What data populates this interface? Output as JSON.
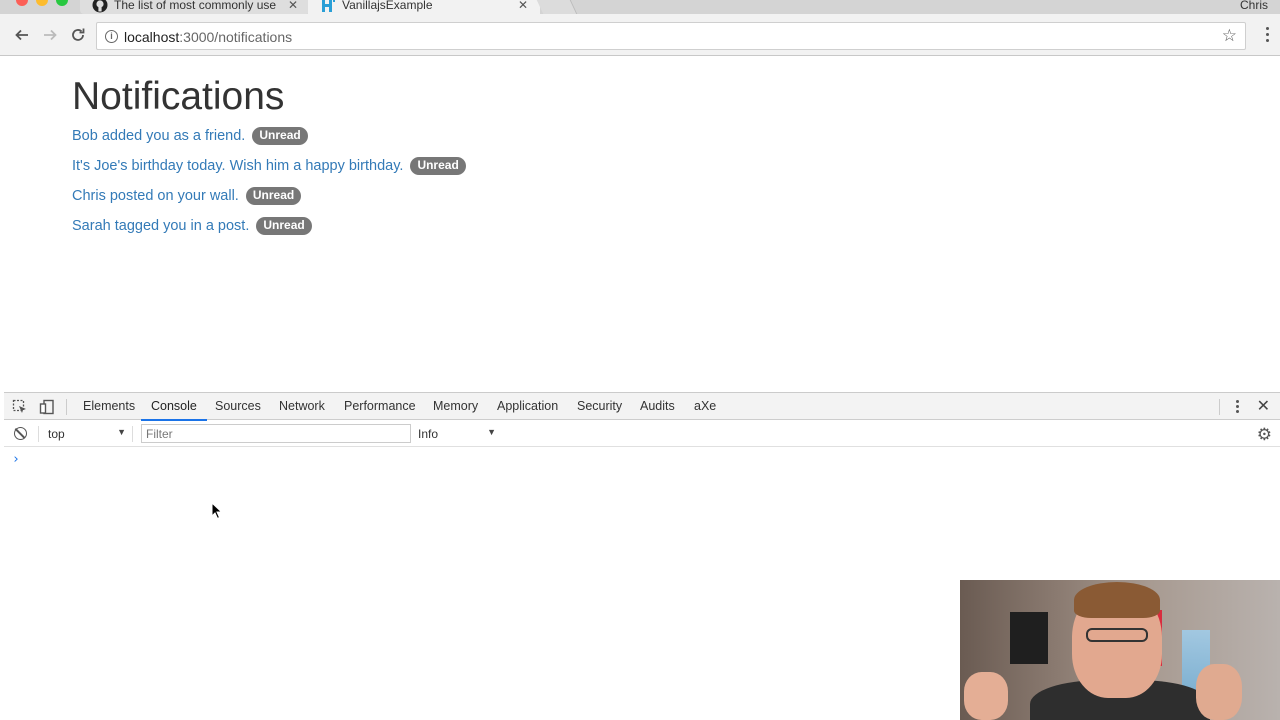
{
  "browser": {
    "tabs": [
      {
        "title": "The list of most commonly use",
        "icon": "github-icon"
      },
      {
        "title": "VanillajsExample",
        "icon": "h-logo-icon"
      }
    ],
    "profile_name": "Chris",
    "url_host": "localhost",
    "url_path": ":3000/notifications"
  },
  "page": {
    "title": "Notifications",
    "notifications": [
      {
        "text": "Bob added you as a friend.",
        "badge": "Unread"
      },
      {
        "text": "It's Joe's birthday today. Wish him a happy birthday.",
        "badge": "Unread"
      },
      {
        "text": "Chris posted on your wall.",
        "badge": "Unread"
      },
      {
        "text": "Sarah tagged you in a post.",
        "badge": "Unread"
      }
    ]
  },
  "devtools": {
    "tabs": [
      "Elements",
      "Console",
      "Sources",
      "Network",
      "Performance",
      "Memory",
      "Application",
      "Security",
      "Audits",
      "aXe"
    ],
    "active_tab": "Console",
    "context": "top",
    "filter_placeholder": "Filter",
    "level": "Info",
    "prompt": "›"
  },
  "colors": {
    "link": "#337ab7",
    "badge": "#777777",
    "devtools_accent": "#1a73e8"
  }
}
